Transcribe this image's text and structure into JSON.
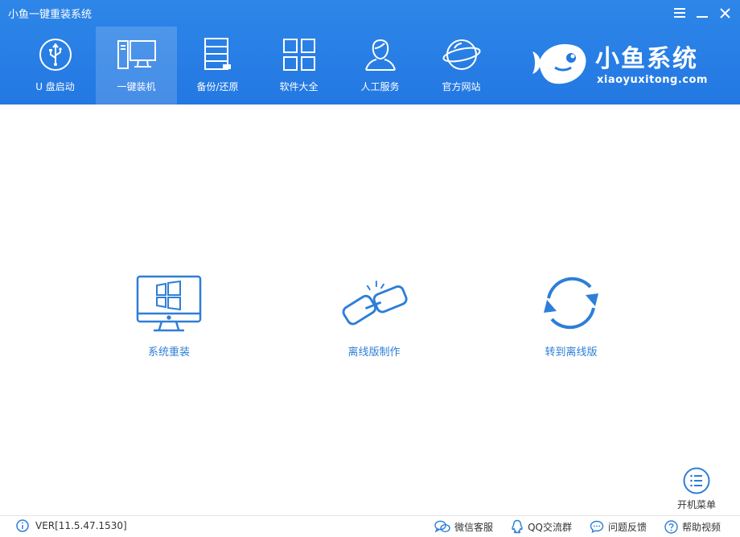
{
  "window": {
    "title": "小鱼一键重装系统"
  },
  "nav": {
    "items": [
      {
        "label": "U 盘启动",
        "icon": "usb-icon"
      },
      {
        "label": "一键装机",
        "icon": "computer-icon",
        "active": true
      },
      {
        "label": "备份/还原",
        "icon": "backup-icon"
      },
      {
        "label": "软件大全",
        "icon": "apps-grid-icon"
      },
      {
        "label": "人工服务",
        "icon": "person-service-icon"
      },
      {
        "label": "官方网站",
        "icon": "globe-icon"
      }
    ]
  },
  "brand": {
    "name": "小鱼系统",
    "url": "xiaoyuxitong.com"
  },
  "actions": [
    {
      "label": "系统重装",
      "icon": "windows-monitor-icon"
    },
    {
      "label": "离线版制作",
      "icon": "broken-link-icon"
    },
    {
      "label": "转到离线版",
      "icon": "refresh-cycle-icon"
    }
  ],
  "boot_menu": {
    "label": "开机菜单",
    "icon": "list-menu-icon"
  },
  "status": {
    "version": "VER[11.5.47.1530]",
    "links": [
      {
        "label": "微信客服",
        "icon": "wechat-icon"
      },
      {
        "label": "QQ交流群",
        "icon": "qq-icon"
      },
      {
        "label": "问题反馈",
        "icon": "feedback-icon"
      },
      {
        "label": "帮助视频",
        "icon": "help-icon"
      }
    ]
  },
  "colors": {
    "header": "#2378e2",
    "accent": "#2d7ed8",
    "text": "#333333"
  }
}
